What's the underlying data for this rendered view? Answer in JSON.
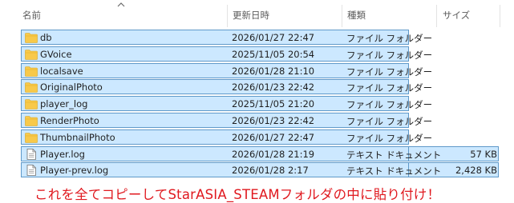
{
  "header": {
    "name_label": "名前",
    "date_label": "更新日時",
    "type_label": "種類",
    "size_label": "サイズ"
  },
  "files": [
    {
      "name": "db",
      "date": "2026/01/27 22:47",
      "type": "ファイル フォルダー",
      "size": "",
      "icon": "folder-icon"
    },
    {
      "name": "GVoice",
      "date": "2025/11/05 20:54",
      "type": "ファイル フォルダー",
      "size": "",
      "icon": "folder-icon"
    },
    {
      "name": "localsave",
      "date": "2026/01/28 21:10",
      "type": "ファイル フォルダー",
      "size": "",
      "icon": "folder-icon"
    },
    {
      "name": "OriginalPhoto",
      "date": "2026/01/23 22:42",
      "type": "ファイル フォルダー",
      "size": "",
      "icon": "folder-icon"
    },
    {
      "name": "player_log",
      "date": "2025/11/05 21:20",
      "type": "ファイル フォルダー",
      "size": "",
      "icon": "folder-icon"
    },
    {
      "name": "RenderPhoto",
      "date": "2026/01/23 22:42",
      "type": "ファイル フォルダー",
      "size": "",
      "icon": "folder-icon"
    },
    {
      "name": "ThumbnailPhoto",
      "date": "2026/01/27 22:47",
      "type": "ファイル フォルダー",
      "size": "",
      "icon": "folder-icon"
    },
    {
      "name": "Player.log",
      "date": "2026/01/28 21:19",
      "type": "テキスト ドキュメント",
      "size": "57 KB",
      "icon": "text-file-icon"
    },
    {
      "name": "Player-prev.log",
      "date": "2026/01/28 2:17",
      "type": "テキスト ドキュメント",
      "size": "2,428 KB",
      "icon": "text-file-icon"
    }
  ],
  "instruction_note": "これを全てコピーしてStarASIA_STEAMフォルダの中に貼り付け！",
  "colors": {
    "selection_fill": "#cce8ff",
    "selection_border": "#5f99c9",
    "folder": "#f8c94a",
    "note": "#e0191f"
  }
}
